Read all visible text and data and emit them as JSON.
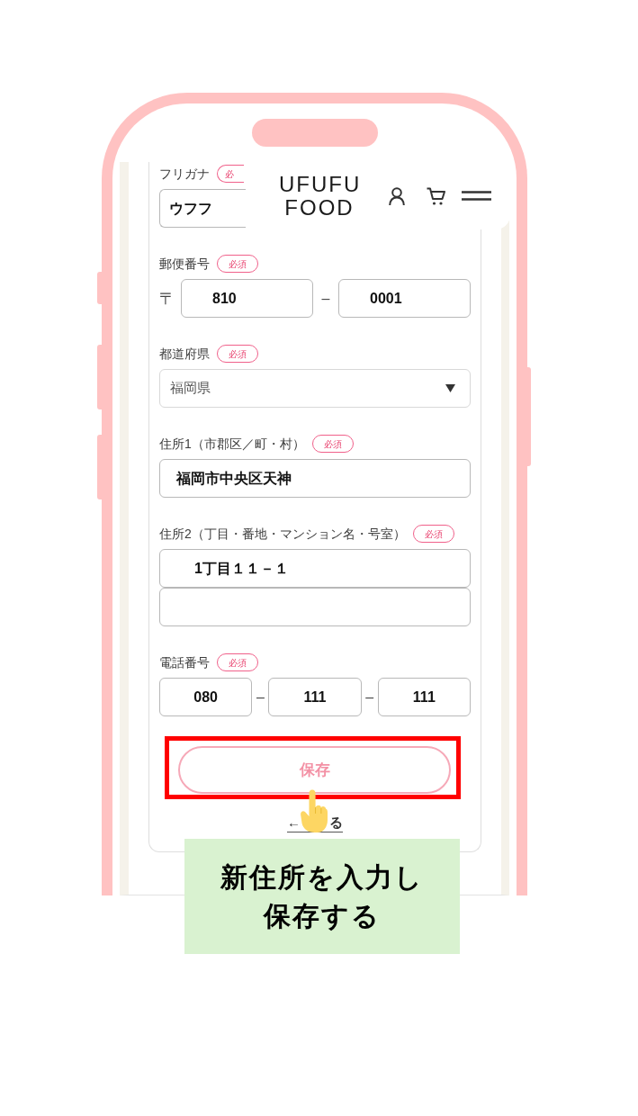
{
  "header": {
    "logo_lines": [
      "UFUFU",
      "FOOD"
    ]
  },
  "form": {
    "fields": [
      {
        "kind": "text",
        "label": "フリガナ",
        "required_badge": "必",
        "value": "ウフフ",
        "partly_covered": true,
        "extra_line": false
      },
      {
        "kind": "postal",
        "label": "郵便番号",
        "required_badge": "必須",
        "prefix": "〒",
        "separators": [
          "–"
        ],
        "values": [
          "810",
          "0001"
        ]
      },
      {
        "kind": "select",
        "label": "都道府県",
        "required_badge": "必須",
        "value": "福岡県"
      },
      {
        "kind": "text",
        "label": "住所1（市郡区／町・村）",
        "required_badge": "必須",
        "value": "福岡市中央区天神",
        "partly_covered": false,
        "extra_line": false
      },
      {
        "kind": "text",
        "label": "住所2（丁目・番地・マンション名・号室）",
        "required_badge": "必須",
        "value": "1丁目１１－１",
        "partly_covered": false,
        "extra_line": true
      },
      {
        "kind": "phone",
        "label": "電話番号",
        "required_badge": "必須",
        "separators": [
          "–",
          "–"
        ],
        "values": [
          "080",
          "111",
          "111"
        ]
      }
    ],
    "save_button": {
      "label": "保存",
      "highlighted": true
    },
    "back_link": {
      "arrow": "←",
      "text": "る"
    }
  },
  "caption_lines": [
    "新住所を入力し",
    "保存する"
  ]
}
